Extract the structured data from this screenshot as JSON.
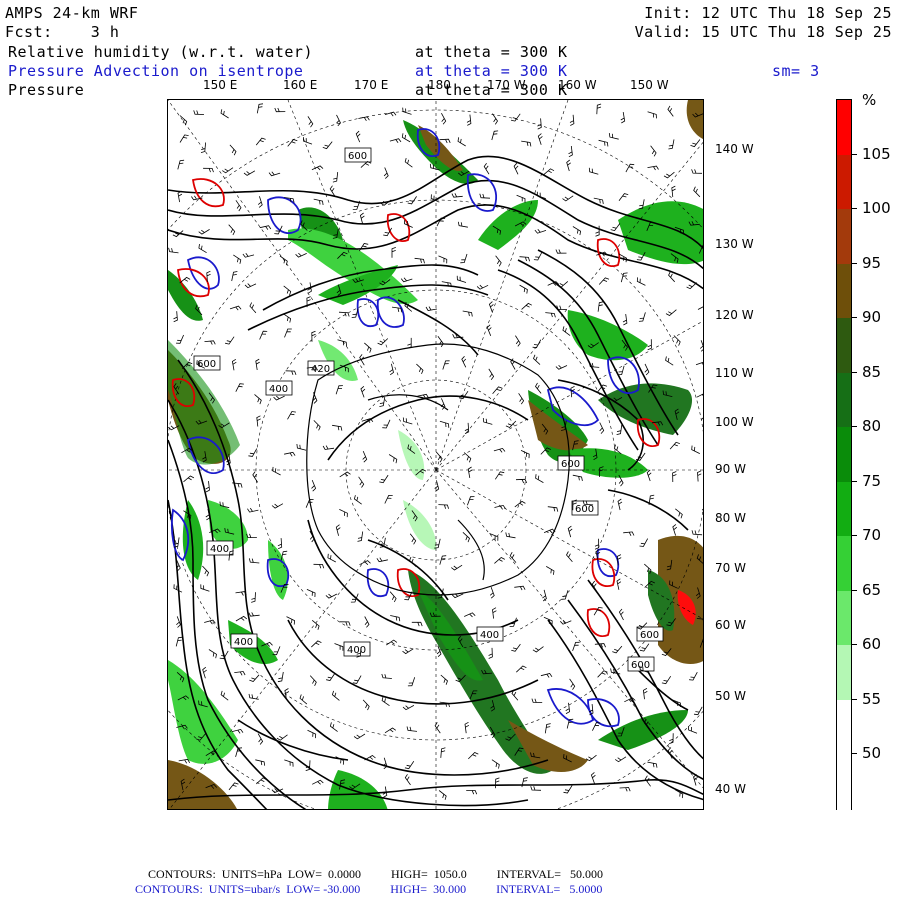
{
  "header": {
    "model": "AMPS 24-km WRF",
    "init": "Init: 12 UTC Thu 18 Sep 25",
    "fcst": "Fcst:    3 h",
    "valid": "Valid: 15 UTC Thu 18 Sep 25",
    "field1": "Relative humidity (w.r.t. water)",
    "field1_level": "at theta = 300 K",
    "field2": "Pressure Advection on isentrope",
    "field2_level": "at theta = 300 K",
    "smoothing": "sm= 3",
    "field3": "Pressure",
    "field3_level": "at theta = 300 K"
  },
  "map": {
    "top_lon_labels": [
      "150 E",
      "160 E",
      "170 E",
      "180",
      "170 W",
      "160 W",
      "150 W"
    ],
    "right_lon_labels": [
      "140 W",
      "130 W",
      "120 W",
      "110 W",
      "100 W",
      "90 W",
      "80 W",
      "70 W",
      "60 W",
      "50 W",
      "40 W"
    ],
    "contour_labels": [
      "600",
      "600",
      "400",
      "420",
      "400",
      "400",
      "600",
      "400",
      "400",
      "600",
      "600",
      "600"
    ]
  },
  "colorbar": {
    "unit": "%",
    "labels": [
      "105",
      "100",
      "95",
      "90",
      "85",
      "80",
      "75",
      "70",
      "65",
      "60",
      "55",
      "50"
    ],
    "colors": [
      "#ff0000",
      "#cc1a00",
      "#a33a0c",
      "#6e4f0a",
      "#2e5a10",
      "#166f16",
      "#0a8c0a",
      "#12ad12",
      "#35d035",
      "#6be86b",
      "#b4f7b4",
      "#ffffff",
      "#ffffff"
    ]
  },
  "footer": {
    "line1": "CONTOURS:  UNITS=hPa  LOW=  0.0000          HIGH=  1050.0          INTERVAL=   50.000",
    "line2": "CONTOURS:  UNITS=ubar/s  LOW= -30.000          HIGH=  30.000          INTERVAL=   5.0000"
  }
}
